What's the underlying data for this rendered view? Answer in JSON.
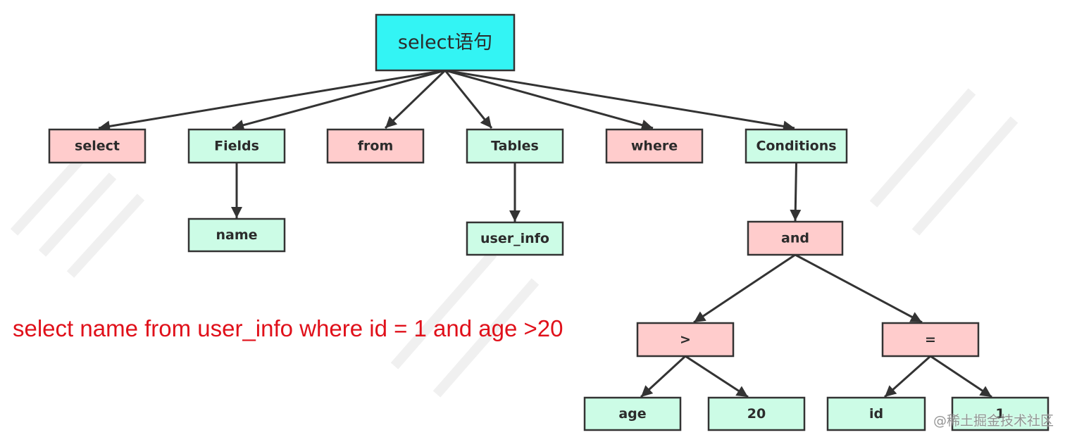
{
  "diagram": {
    "title": "select语句",
    "colors": {
      "root": "#33f4f4",
      "keyword": "#ffcccc",
      "operand": "#ccfce6",
      "edge": "#333333",
      "sql_text": "#e0101a"
    },
    "nodes": [
      {
        "id": "root",
        "label": "select语句",
        "kind": "root"
      },
      {
        "id": "select",
        "label": "select",
        "kind": "keyword"
      },
      {
        "id": "fields",
        "label": "Fields",
        "kind": "operand"
      },
      {
        "id": "from",
        "label": "from",
        "kind": "keyword"
      },
      {
        "id": "tables",
        "label": "Tables",
        "kind": "operand"
      },
      {
        "id": "where",
        "label": "where",
        "kind": "keyword"
      },
      {
        "id": "conditions",
        "label": "Conditions",
        "kind": "operand"
      },
      {
        "id": "name",
        "label": "name",
        "kind": "operand"
      },
      {
        "id": "user_info",
        "label": "user_info",
        "kind": "operand"
      },
      {
        "id": "and",
        "label": "and",
        "kind": "keyword"
      },
      {
        "id": "gt",
        "label": ">",
        "kind": "keyword"
      },
      {
        "id": "eq",
        "label": "=",
        "kind": "keyword"
      },
      {
        "id": "age",
        "label": "age",
        "kind": "operand"
      },
      {
        "id": "twenty",
        "label": "20",
        "kind": "operand"
      },
      {
        "id": "id",
        "label": "id",
        "kind": "operand"
      },
      {
        "id": "one",
        "label": "1",
        "kind": "operand"
      }
    ],
    "edges": [
      [
        "root",
        "select"
      ],
      [
        "root",
        "fields"
      ],
      [
        "root",
        "from"
      ],
      [
        "root",
        "tables"
      ],
      [
        "root",
        "where"
      ],
      [
        "root",
        "conditions"
      ],
      [
        "fields",
        "name"
      ],
      [
        "tables",
        "user_info"
      ],
      [
        "conditions",
        "and"
      ],
      [
        "and",
        "gt"
      ],
      [
        "and",
        "eq"
      ],
      [
        "gt",
        "age"
      ],
      [
        "gt",
        "twenty"
      ],
      [
        "eq",
        "id"
      ],
      [
        "eq",
        "one"
      ]
    ]
  },
  "sql_statement": "select name from user_info where id = 1 and age >20",
  "watermark": "@稀土掘金技术社区"
}
